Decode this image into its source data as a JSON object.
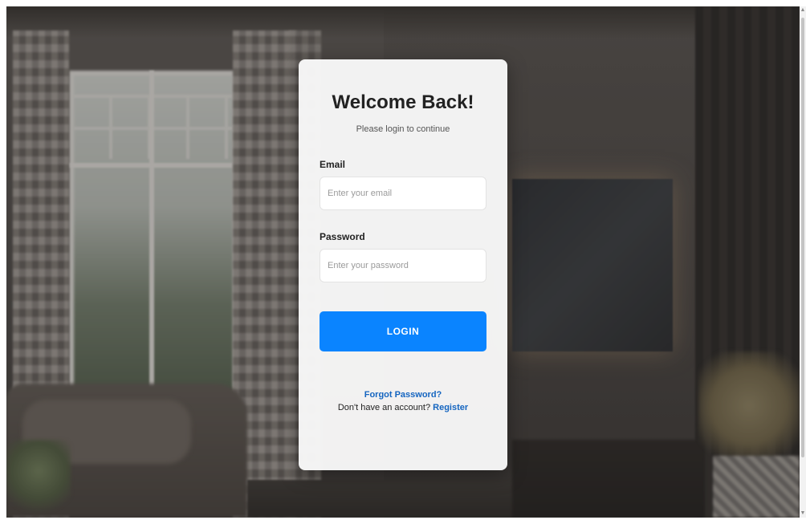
{
  "login": {
    "title": "Welcome Back!",
    "subtitle": "Please login to continue",
    "email": {
      "label": "Email",
      "value": "",
      "placeholder": "Enter your email"
    },
    "password": {
      "label": "Password",
      "value": "",
      "placeholder": "Enter your password"
    },
    "submit_label": "LOGIN",
    "forgot_password_label": "Forgot Password?",
    "register_prompt": "Don't have an account?",
    "register_label": "Register"
  },
  "colors": {
    "accent": "#0a84ff",
    "link": "#1565c0",
    "card_background": "#f8f8f8"
  },
  "icons": {
    "scroll_up": "scroll-up-arrow-icon",
    "scroll_down": "scroll-down-arrow-icon"
  }
}
